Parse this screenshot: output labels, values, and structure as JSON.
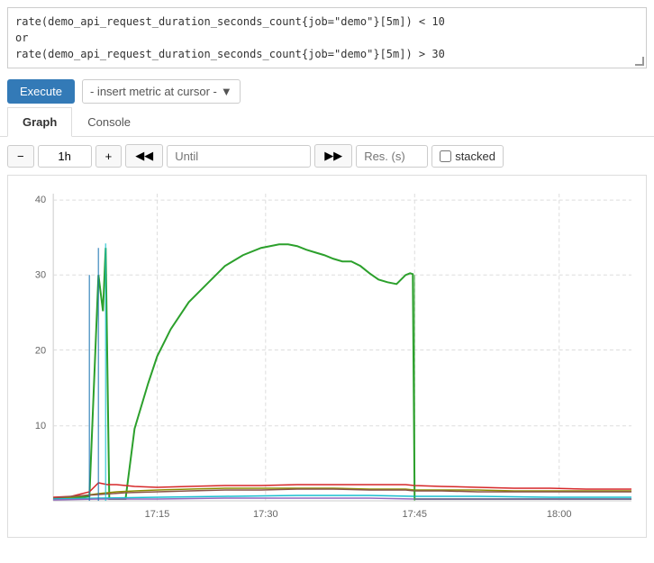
{
  "query": {
    "line1": "rate(demo_api_request_duration_seconds_count{job=\"demo\"}[5m]) < 10",
    "line2": "or",
    "line3": "  rate(demo_api_request_duration_seconds_count{job=\"demo\"}[5m]) > 30"
  },
  "toolbar": {
    "execute_label": "Execute",
    "insert_metric_label": "- insert metric at cursor -"
  },
  "tabs": [
    {
      "label": "Graph",
      "active": true
    },
    {
      "label": "Console",
      "active": false
    }
  ],
  "graph_controls": {
    "minus_label": "−",
    "range_value": "1h",
    "plus_label": "+",
    "prev_label": "◀◀",
    "until_placeholder": "Until",
    "next_label": "▶▶",
    "res_placeholder": "Res. (s)",
    "stacked_label": "stacked"
  },
  "graph": {
    "y_labels": [
      "10",
      "20",
      "30",
      "40"
    ],
    "x_labels": [
      "17:15",
      "17:30",
      "17:45",
      "18:00"
    ]
  }
}
